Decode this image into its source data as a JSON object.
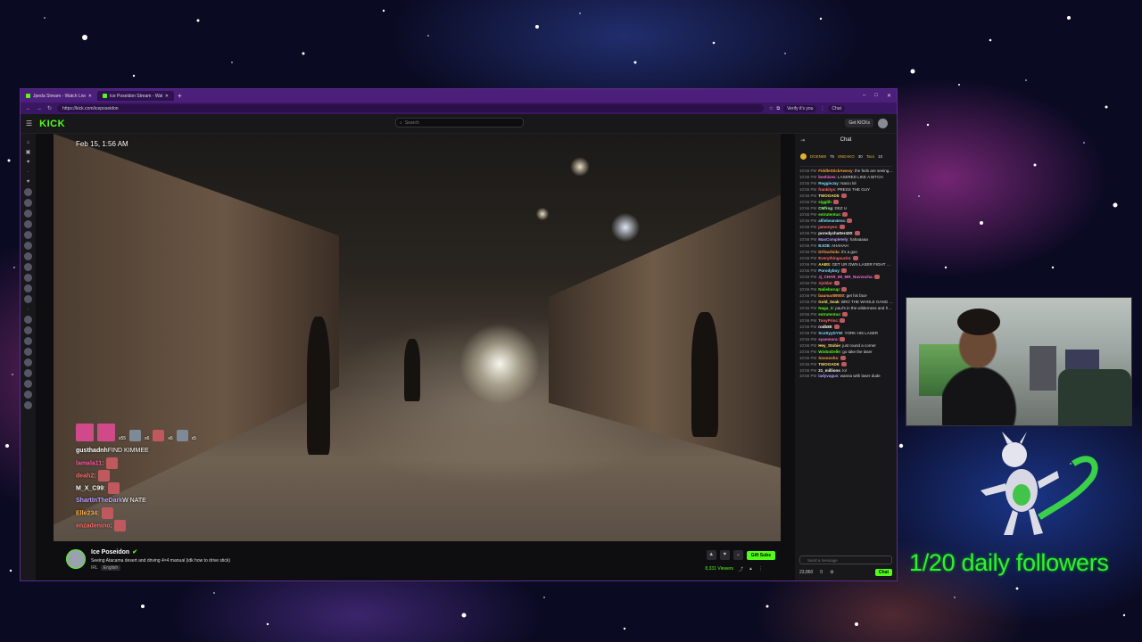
{
  "browser": {
    "tabs": [
      {
        "title": "Jpeda Stream - Watch Live on Ki...",
        "active": false
      },
      {
        "title": "Ice Poseidon Stream - Watch...",
        "active": true
      }
    ],
    "url": "https://kick.com/iceposeidon",
    "profile_label": "Verify it's you",
    "chat_button_label": "Chat"
  },
  "site": {
    "logo": "KICK",
    "search_placeholder": "Search",
    "get_kicks_label": "Get KICKs"
  },
  "player": {
    "timestamp": "Feb 15, 1:56 AM",
    "overlay_chat": [
      {
        "user": "gusthadnh",
        "text": "FIND KIMMEE",
        "color": "#ffffff"
      },
      {
        "user": "lamala11",
        "text": ":",
        "color": "#ff5aa0"
      },
      {
        "user": "deah2",
        "text": ":",
        "color": "#ff6b6b"
      },
      {
        "user": "M_X_C99",
        "text": ":",
        "color": "#ffffff"
      },
      {
        "user": "ShartInTheDark",
        "text": "W NATE",
        "color": "#b9a0ff"
      },
      {
        "user": "Elle234",
        "text": ":",
        "color": "#ffb347"
      },
      {
        "user": "enzadenino",
        "text": ":",
        "color": "#ff6b6b"
      }
    ],
    "emote_counts": [
      "x55",
      "x6",
      "x6",
      "x5"
    ]
  },
  "channel": {
    "name": "Ice Poseidon",
    "title": "Seeing Atacama desert and driving 4×4 manual (idk how to drive stick)",
    "category": "IRL",
    "language": "English",
    "gift_subs_label": "Gift Subs",
    "viewers": "8,331 Viewers"
  },
  "chat": {
    "header": "Chat",
    "pinned": [
      {
        "name": "DGEN88",
        "value": "75"
      },
      {
        "name": "SNEAKO",
        "value": "30"
      },
      {
        "name": "Tacs",
        "value": "10"
      }
    ],
    "messages": [
      {
        "time": "10:55 PM",
        "user": "FiddleStickAwesy",
        "text": "the feds are seeing coco",
        "color": "#ff9e40"
      },
      {
        "time": "10:55 PM",
        "user": "beehives",
        "text": "LASERED LIKE A BITCH",
        "color": "#ff6bd6"
      },
      {
        "time": "10:55 PM",
        "user": "ReggieJay",
        "text": "Nacio lol",
        "color": "#7bdcff"
      },
      {
        "time": "10:55 PM",
        "user": "frankitys",
        "text": "PRESS THE GUY",
        "color": "#ff6b6b"
      },
      {
        "time": "10:56 PM",
        "user": "TWOOAD5",
        "text": "",
        "color": "#ffe066"
      },
      {
        "time": "10:56 PM",
        "user": "sigglih",
        "text": "",
        "color": "#53fc18"
      },
      {
        "time": "10:56 PM",
        "user": "CMfrog",
        "text": "DEZ U",
        "color": "#a0ffa0"
      },
      {
        "time": "10:56 PM",
        "user": "estrutentus",
        "text": "",
        "color": "#53fc18"
      },
      {
        "time": "10:56 PM",
        "user": "alfiebean4eva",
        "text": "",
        "color": "#7bdcff"
      },
      {
        "time": "10:56 PM",
        "user": "jamonyes",
        "text": "",
        "color": "#ff6b6b"
      },
      {
        "time": "10:56 PM",
        "user": "porodychatter420",
        "text": "",
        "color": "#ffffff"
      },
      {
        "time": "10:56 PM",
        "user": "MasCompletely",
        "text": "hahaaaaa",
        "color": "#b9a0ff"
      },
      {
        "time": "10:56 PM",
        "user": "BJOB",
        "text": "AHAHAH",
        "color": "#7bdcff"
      },
      {
        "time": "10:56 PM",
        "user": "DrlGarbida",
        "text": "it's a gun",
        "color": "#ff9e40"
      },
      {
        "time": "10:56 PM",
        "user": "Everythingsucks",
        "text": "",
        "color": "#ff6b6b"
      },
      {
        "time": "10:56 PM",
        "user": "AABS",
        "text": "GET UR OWN LASER FIGHT BACK XDXLOE",
        "color": "#ffe066"
      },
      {
        "time": "10:56 PM",
        "user": "Porodyboy",
        "text": "",
        "color": "#7bdcff"
      },
      {
        "time": "10:56 PM",
        "user": "Jj_CHAR_69_MR_Nuvvocha",
        "text": "",
        "color": "#ff6bd6"
      },
      {
        "time": "10:56 PM",
        "user": "Ajoldat",
        "text": "",
        "color": "#ff6b6b"
      },
      {
        "time": "10:56 PM",
        "user": "Nalieborup",
        "text": "",
        "color": "#53fc18"
      },
      {
        "time": "10:56 PM",
        "user": "baumar89000",
        "text": "get his face",
        "color": "#ff9e40"
      },
      {
        "time": "10:56 PM",
        "user": "Gold_Seak",
        "text": "BRO THE WHOLE GANG FOLLOWING YOU",
        "color": "#ffe066"
      },
      {
        "time": "10:56 PM",
        "user": "Naga_X",
        "text": "paul's in the wilderness and he doesnt even know it",
        "color": "#53fc18"
      },
      {
        "time": "10:56 PM",
        "user": "estrutentus",
        "text": "",
        "color": "#53fc18"
      },
      {
        "time": "10:56 PM",
        "user": "TonyPrinc",
        "text": "",
        "color": "#ff6b6b"
      },
      {
        "time": "10:56 PM",
        "user": "rodb80",
        "text": "",
        "color": "#ffffff"
      },
      {
        "time": "10:56 PM",
        "user": "ScottyyDYW",
        "text": "YORK HIS LASER",
        "color": "#7bdcff"
      },
      {
        "time": "10:56 PM",
        "user": "syanmora",
        "text": "",
        "color": "#ff6bd6"
      },
      {
        "time": "10:56 PM",
        "user": "Hey_Stobie",
        "text": "just round a corner",
        "color": "#ffe066"
      },
      {
        "time": "10:56 PM",
        "user": "WinboDelle",
        "text": "go take the laser",
        "color": "#53fc18"
      },
      {
        "time": "10:56 PM",
        "user": "Sooooshs",
        "text": "",
        "color": "#ff9e40"
      },
      {
        "time": "10:56 PM",
        "user": "TWOOAD5",
        "text": "",
        "color": "#ffe066"
      },
      {
        "time": "10:56 PM",
        "user": "21_millions",
        "text": "lol",
        "color": "#ffffff"
      },
      {
        "time": "10:56 PM",
        "user": "ladyvagus",
        "text": "wanna with laser dude",
        "color": "#b9a0ff"
      }
    ],
    "input_placeholder": "Send a message",
    "points": "23,860",
    "count": "0",
    "chat_button": "Chat"
  },
  "overlay": {
    "followers_text": "1/20 daily followers"
  },
  "colors": {
    "brand": "#53fc18",
    "browser_frame": "#4b1f7a",
    "followers": "#33ee33"
  }
}
